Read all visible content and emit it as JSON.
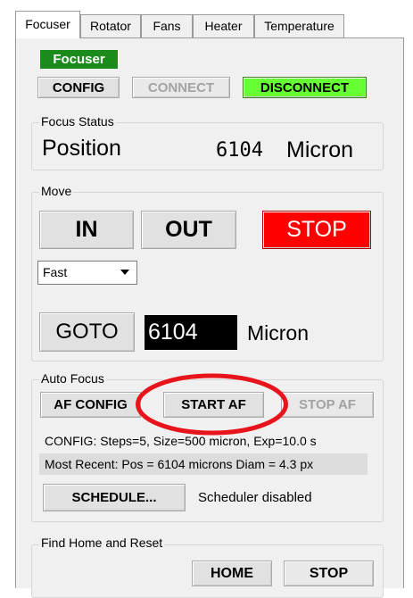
{
  "tabs": [
    {
      "label": "Focuser",
      "active": true
    },
    {
      "label": "Rotator",
      "active": false
    },
    {
      "label": "Fans",
      "active": false
    },
    {
      "label": "Heater",
      "active": false
    },
    {
      "label": "Temperature",
      "active": false
    }
  ],
  "header": {
    "badge": "Focuser",
    "badge_color": "#1b8b1b",
    "config": "CONFIG",
    "connect": "CONNECT",
    "disconnect": "DISCONNECT",
    "disconnect_color": "#66ff33"
  },
  "focus_status": {
    "title": "Focus Status",
    "position_label": "Position",
    "position_value": "6104",
    "unit": "Micron"
  },
  "move": {
    "title": "Move",
    "in": "IN",
    "out": "OUT",
    "stop": "STOP",
    "stop_color": "#ff0000",
    "speed_selected": "Fast",
    "goto": "GOTO",
    "goto_value": "6104",
    "goto_unit": "Micron"
  },
  "auto_focus": {
    "title": "Auto Focus",
    "af_config": "AF CONFIG",
    "start_af": "START AF",
    "stop_af": "STOP AF",
    "config_line": "CONFIG: Steps=5, Size=500 micron, Exp=10.0 s",
    "most_recent_line": "Most Recent:  Pos = 6104 microns   Diam = 4.3 px",
    "schedule": "SCHEDULE...",
    "scheduler_status": "Scheduler disabled",
    "highlight_color": "#e8141b"
  },
  "home": {
    "title": "Find Home and Reset",
    "home": "HOME",
    "stop": "STOP"
  }
}
